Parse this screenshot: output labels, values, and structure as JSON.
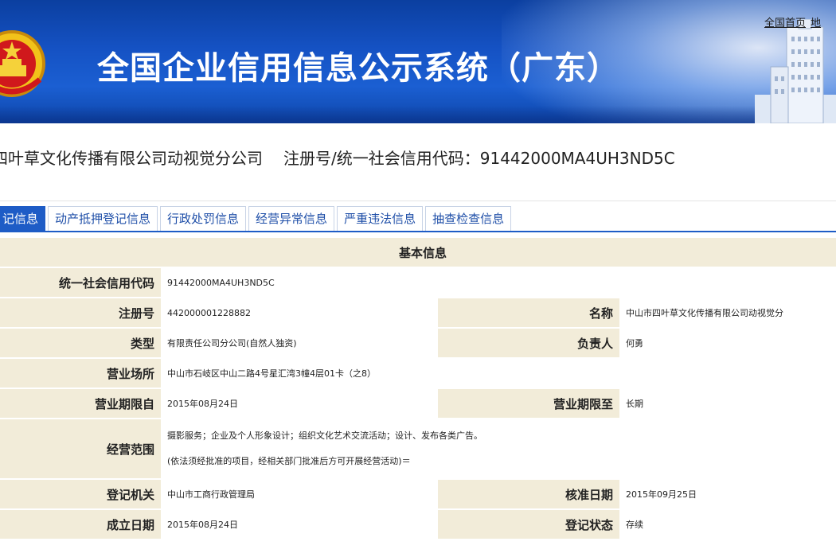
{
  "header": {
    "title": "全国企业信用信息公示系统（广东）",
    "links": [
      "全国首页",
      "地"
    ],
    "emblem_icon": "national-emblem-icon",
    "building_icon": "government-building-icon",
    "colors": {
      "banner": "#1552c4",
      "tab_active": "#1e5cc6",
      "label_bg": "#f2ecd9"
    }
  },
  "company": {
    "name": "四叶草文化传播有限公司动视觉分公司",
    "code_label": "注册号/统一社会信用代码：",
    "code": "91442000MA4UH3ND5C"
  },
  "tabs": [
    {
      "label": "记信息",
      "active": true
    },
    {
      "label": "动产抵押登记信息",
      "active": false
    },
    {
      "label": "行政处罚信息",
      "active": false
    },
    {
      "label": "经营异常信息",
      "active": false
    },
    {
      "label": "严重违法信息",
      "active": false
    },
    {
      "label": "抽查检查信息",
      "active": false
    }
  ],
  "basic": {
    "section_title": "基本信息",
    "credit_code_label": "统一社会信用代码",
    "credit_code": "91442000MA4UH3ND5C",
    "reg_no_label": "注册号",
    "reg_no": "442000001228882",
    "name_label": "名称",
    "name": "中山市四叶草文化传播有限公司动视觉分",
    "type_label": "类型",
    "type": "有限责任公司分公司(自然人独资)",
    "manager_label": "负责人",
    "manager": "何勇",
    "address_label": "营业场所",
    "address": "中山市石岐区中山二路4号星汇湾3幢4层01卡（之8）",
    "period_from_label": "营业期限自",
    "period_from": "2015年08月24日",
    "period_to_label": "营业期限至",
    "period_to": "长期",
    "scope_label": "经营范围",
    "scope_line1": "摄影服务；企业及个人形象设计；组织文化艺术交流活动；设计、发布各类广告。",
    "scope_line2": "(依法须经批准的项目，经相关部门批准后方可开展经营活动)＝",
    "authority_label": "登记机关",
    "authority": "中山市工商行政管理局",
    "approval_date_label": "核准日期",
    "approval_date": "2015年09月25日",
    "established_label": "成立日期",
    "established": "2015年08月24日",
    "status_label": "登记状态",
    "status": "存续"
  }
}
